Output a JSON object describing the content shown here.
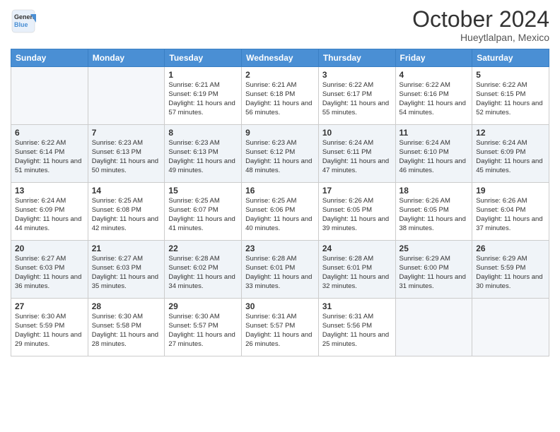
{
  "header": {
    "logo_general": "General",
    "logo_blue": "Blue",
    "month": "October 2024",
    "location": "Hueytlalpan, Mexico"
  },
  "days_of_week": [
    "Sunday",
    "Monday",
    "Tuesday",
    "Wednesday",
    "Thursday",
    "Friday",
    "Saturday"
  ],
  "weeks": [
    [
      {
        "day": "",
        "sunrise": "",
        "sunset": "",
        "daylight": ""
      },
      {
        "day": "",
        "sunrise": "",
        "sunset": "",
        "daylight": ""
      },
      {
        "day": "1",
        "sunrise": "Sunrise: 6:21 AM",
        "sunset": "Sunset: 6:19 PM",
        "daylight": "Daylight: 11 hours and 57 minutes."
      },
      {
        "day": "2",
        "sunrise": "Sunrise: 6:21 AM",
        "sunset": "Sunset: 6:18 PM",
        "daylight": "Daylight: 11 hours and 56 minutes."
      },
      {
        "day": "3",
        "sunrise": "Sunrise: 6:22 AM",
        "sunset": "Sunset: 6:17 PM",
        "daylight": "Daylight: 11 hours and 55 minutes."
      },
      {
        "day": "4",
        "sunrise": "Sunrise: 6:22 AM",
        "sunset": "Sunset: 6:16 PM",
        "daylight": "Daylight: 11 hours and 54 minutes."
      },
      {
        "day": "5",
        "sunrise": "Sunrise: 6:22 AM",
        "sunset": "Sunset: 6:15 PM",
        "daylight": "Daylight: 11 hours and 52 minutes."
      }
    ],
    [
      {
        "day": "6",
        "sunrise": "Sunrise: 6:22 AM",
        "sunset": "Sunset: 6:14 PM",
        "daylight": "Daylight: 11 hours and 51 minutes."
      },
      {
        "day": "7",
        "sunrise": "Sunrise: 6:23 AM",
        "sunset": "Sunset: 6:13 PM",
        "daylight": "Daylight: 11 hours and 50 minutes."
      },
      {
        "day": "8",
        "sunrise": "Sunrise: 6:23 AM",
        "sunset": "Sunset: 6:13 PM",
        "daylight": "Daylight: 11 hours and 49 minutes."
      },
      {
        "day": "9",
        "sunrise": "Sunrise: 6:23 AM",
        "sunset": "Sunset: 6:12 PM",
        "daylight": "Daylight: 11 hours and 48 minutes."
      },
      {
        "day": "10",
        "sunrise": "Sunrise: 6:24 AM",
        "sunset": "Sunset: 6:11 PM",
        "daylight": "Daylight: 11 hours and 47 minutes."
      },
      {
        "day": "11",
        "sunrise": "Sunrise: 6:24 AM",
        "sunset": "Sunset: 6:10 PM",
        "daylight": "Daylight: 11 hours and 46 minutes."
      },
      {
        "day": "12",
        "sunrise": "Sunrise: 6:24 AM",
        "sunset": "Sunset: 6:09 PM",
        "daylight": "Daylight: 11 hours and 45 minutes."
      }
    ],
    [
      {
        "day": "13",
        "sunrise": "Sunrise: 6:24 AM",
        "sunset": "Sunset: 6:09 PM",
        "daylight": "Daylight: 11 hours and 44 minutes."
      },
      {
        "day": "14",
        "sunrise": "Sunrise: 6:25 AM",
        "sunset": "Sunset: 6:08 PM",
        "daylight": "Daylight: 11 hours and 42 minutes."
      },
      {
        "day": "15",
        "sunrise": "Sunrise: 6:25 AM",
        "sunset": "Sunset: 6:07 PM",
        "daylight": "Daylight: 11 hours and 41 minutes."
      },
      {
        "day": "16",
        "sunrise": "Sunrise: 6:25 AM",
        "sunset": "Sunset: 6:06 PM",
        "daylight": "Daylight: 11 hours and 40 minutes."
      },
      {
        "day": "17",
        "sunrise": "Sunrise: 6:26 AM",
        "sunset": "Sunset: 6:05 PM",
        "daylight": "Daylight: 11 hours and 39 minutes."
      },
      {
        "day": "18",
        "sunrise": "Sunrise: 6:26 AM",
        "sunset": "Sunset: 6:05 PM",
        "daylight": "Daylight: 11 hours and 38 minutes."
      },
      {
        "day": "19",
        "sunrise": "Sunrise: 6:26 AM",
        "sunset": "Sunset: 6:04 PM",
        "daylight": "Daylight: 11 hours and 37 minutes."
      }
    ],
    [
      {
        "day": "20",
        "sunrise": "Sunrise: 6:27 AM",
        "sunset": "Sunset: 6:03 PM",
        "daylight": "Daylight: 11 hours and 36 minutes."
      },
      {
        "day": "21",
        "sunrise": "Sunrise: 6:27 AM",
        "sunset": "Sunset: 6:03 PM",
        "daylight": "Daylight: 11 hours and 35 minutes."
      },
      {
        "day": "22",
        "sunrise": "Sunrise: 6:28 AM",
        "sunset": "Sunset: 6:02 PM",
        "daylight": "Daylight: 11 hours and 34 minutes."
      },
      {
        "day": "23",
        "sunrise": "Sunrise: 6:28 AM",
        "sunset": "Sunset: 6:01 PM",
        "daylight": "Daylight: 11 hours and 33 minutes."
      },
      {
        "day": "24",
        "sunrise": "Sunrise: 6:28 AM",
        "sunset": "Sunset: 6:01 PM",
        "daylight": "Daylight: 11 hours and 32 minutes."
      },
      {
        "day": "25",
        "sunrise": "Sunrise: 6:29 AM",
        "sunset": "Sunset: 6:00 PM",
        "daylight": "Daylight: 11 hours and 31 minutes."
      },
      {
        "day": "26",
        "sunrise": "Sunrise: 6:29 AM",
        "sunset": "Sunset: 5:59 PM",
        "daylight": "Daylight: 11 hours and 30 minutes."
      }
    ],
    [
      {
        "day": "27",
        "sunrise": "Sunrise: 6:30 AM",
        "sunset": "Sunset: 5:59 PM",
        "daylight": "Daylight: 11 hours and 29 minutes."
      },
      {
        "day": "28",
        "sunrise": "Sunrise: 6:30 AM",
        "sunset": "Sunset: 5:58 PM",
        "daylight": "Daylight: 11 hours and 28 minutes."
      },
      {
        "day": "29",
        "sunrise": "Sunrise: 6:30 AM",
        "sunset": "Sunset: 5:57 PM",
        "daylight": "Daylight: 11 hours and 27 minutes."
      },
      {
        "day": "30",
        "sunrise": "Sunrise: 6:31 AM",
        "sunset": "Sunset: 5:57 PM",
        "daylight": "Daylight: 11 hours and 26 minutes."
      },
      {
        "day": "31",
        "sunrise": "Sunrise: 6:31 AM",
        "sunset": "Sunset: 5:56 PM",
        "daylight": "Daylight: 11 hours and 25 minutes."
      },
      {
        "day": "",
        "sunrise": "",
        "sunset": "",
        "daylight": ""
      },
      {
        "day": "",
        "sunrise": "",
        "sunset": "",
        "daylight": ""
      }
    ]
  ]
}
